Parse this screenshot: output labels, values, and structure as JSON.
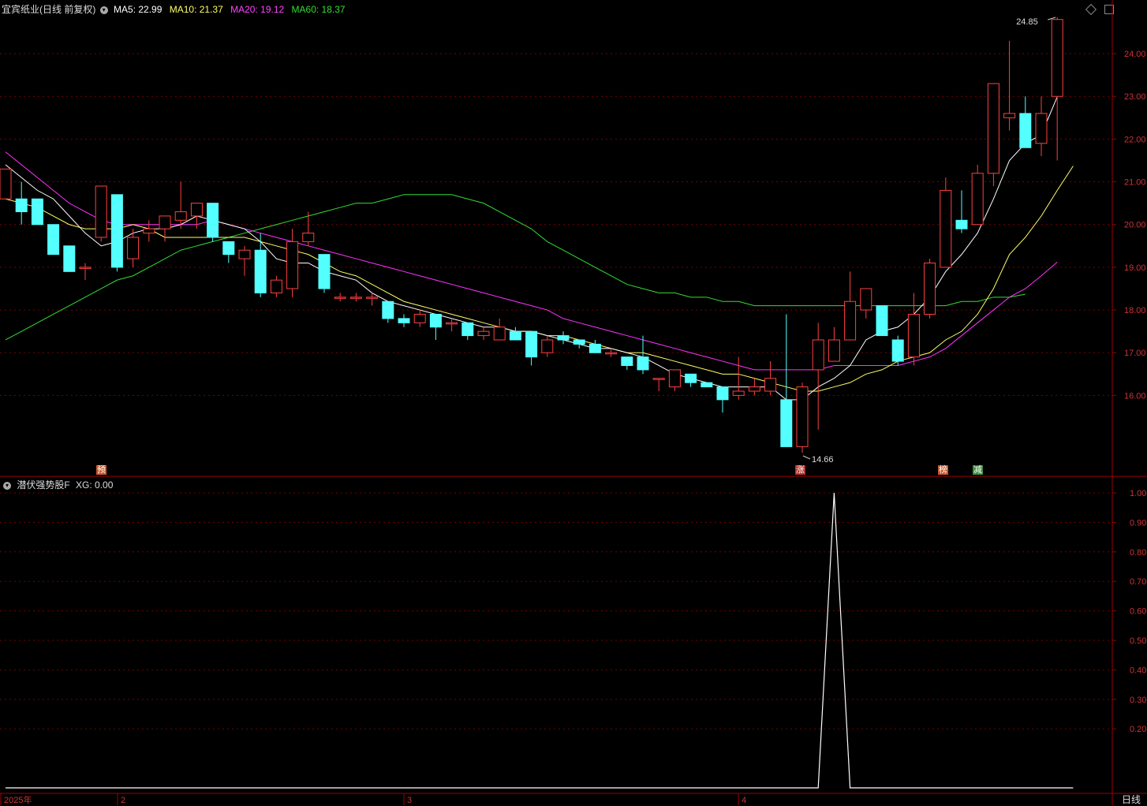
{
  "header": {
    "title": "宜宾纸业(日线 前复权)",
    "ma5_label": "MA5: 22.99",
    "ma10_label": "MA10: 21.37",
    "ma20_label": "MA20: 19.12",
    "ma60_label": "MA60: 18.37"
  },
  "indicator": {
    "name": "潜伏强势股F",
    "value_label": "XG: 0.00"
  },
  "footer": {
    "period_label": "日线"
  },
  "signals": [
    {
      "text": "预",
      "color": "#c8552a"
    },
    {
      "text": "涨",
      "color": "#b0302a"
    },
    {
      "text": "榜",
      "color": "#c8552a"
    },
    {
      "text": "减",
      "color": "#3a8a3a"
    }
  ],
  "colors": {
    "up": "#ff4040",
    "down": "#54ffff",
    "ma5": "#ffffff",
    "ma10": "#ffff66",
    "ma20": "#ff33ff",
    "ma60": "#33dd33",
    "axis": "#a00000",
    "grid": "#7a0000"
  },
  "chart_data": [
    {
      "type": "candlestick",
      "ylim": [
        14.5,
        25.0
      ],
      "yticks": [
        "16.00",
        "17.00",
        "18.00",
        "19.00",
        "20.00",
        "21.00",
        "22.00",
        "23.00",
        "24.00"
      ],
      "xticks": [
        "2025年",
        "2",
        "3",
        "4"
      ],
      "annotations": {
        "high": "24.85",
        "low": "14.66"
      },
      "series_names": [
        "MA5",
        "MA10",
        "MA20",
        "MA60"
      ],
      "ohlc": [
        [
          20.6,
          21.3,
          20.6,
          21.3
        ],
        [
          20.6,
          21.0,
          20.0,
          20.3
        ],
        [
          20.6,
          20.6,
          20.0,
          20.0
        ],
        [
          20.0,
          20.0,
          19.3,
          19.3
        ],
        [
          19.5,
          19.5,
          18.9,
          18.9
        ],
        [
          19.0,
          19.1,
          18.7,
          19.0
        ],
        [
          19.7,
          20.9,
          19.6,
          20.9
        ],
        [
          20.7,
          20.7,
          18.9,
          19.0
        ],
        [
          19.2,
          19.9,
          19.0,
          19.7
        ],
        [
          19.8,
          20.1,
          19.6,
          19.9
        ],
        [
          19.9,
          20.2,
          19.6,
          20.2
        ],
        [
          20.1,
          21.0,
          19.9,
          20.3
        ],
        [
          20.2,
          20.5,
          19.9,
          20.5
        ],
        [
          20.5,
          20.5,
          19.6,
          19.7
        ],
        [
          19.6,
          19.6,
          19.1,
          19.3
        ],
        [
          19.2,
          19.5,
          18.8,
          19.4
        ],
        [
          19.4,
          19.8,
          18.3,
          18.4
        ],
        [
          18.4,
          18.8,
          18.3,
          18.7
        ],
        [
          18.5,
          19.9,
          18.3,
          19.6
        ],
        [
          19.6,
          20.3,
          19.5,
          19.8
        ],
        [
          19.3,
          19.3,
          18.4,
          18.5
        ],
        [
          18.3,
          18.4,
          18.2,
          18.3
        ],
        [
          18.3,
          18.4,
          18.2,
          18.3
        ],
        [
          18.3,
          18.4,
          18.1,
          18.3
        ],
        [
          18.2,
          18.2,
          17.7,
          17.8
        ],
        [
          17.8,
          17.9,
          17.6,
          17.7
        ],
        [
          17.7,
          18.0,
          17.6,
          17.9
        ],
        [
          17.9,
          17.9,
          17.3,
          17.6
        ],
        [
          17.7,
          17.8,
          17.5,
          17.7
        ],
        [
          17.7,
          17.7,
          17.3,
          17.4
        ],
        [
          17.4,
          17.6,
          17.3,
          17.5
        ],
        [
          17.3,
          17.8,
          17.3,
          17.6
        ],
        [
          17.5,
          17.6,
          17.3,
          17.3
        ],
        [
          17.5,
          17.5,
          16.7,
          16.9
        ],
        [
          17.0,
          17.4,
          16.9,
          17.3
        ],
        [
          17.4,
          17.5,
          17.2,
          17.3
        ],
        [
          17.3,
          17.3,
          17.1,
          17.2
        ],
        [
          17.2,
          17.3,
          17.0,
          17.0
        ],
        [
          17.0,
          17.1,
          16.9,
          17.0
        ],
        [
          16.9,
          16.9,
          16.6,
          16.7
        ],
        [
          16.9,
          17.4,
          16.5,
          16.6
        ],
        [
          16.4,
          16.4,
          16.1,
          16.4
        ],
        [
          16.2,
          16.6,
          16.1,
          16.6
        ],
        [
          16.5,
          16.5,
          16.2,
          16.3
        ],
        [
          16.3,
          16.3,
          16.2,
          16.2
        ],
        [
          16.2,
          16.2,
          15.6,
          15.9
        ],
        [
          16.0,
          16.9,
          15.9,
          16.1
        ],
        [
          16.1,
          16.4,
          16.0,
          16.2
        ],
        [
          16.1,
          16.8,
          16.0,
          16.4
        ],
        [
          15.9,
          17.9,
          14.8,
          14.8
        ],
        [
          14.8,
          16.3,
          14.66,
          16.2
        ],
        [
          16.6,
          17.7,
          15.2,
          17.3
        ],
        [
          16.8,
          17.6,
          16.8,
          17.3
        ],
        [
          17.3,
          18.9,
          17.3,
          18.2
        ],
        [
          18.0,
          18.5,
          17.8,
          18.5
        ],
        [
          18.1,
          18.1,
          17.4,
          17.4
        ],
        [
          17.3,
          17.4,
          16.7,
          16.8
        ],
        [
          16.9,
          18.4,
          16.7,
          17.9
        ],
        [
          17.9,
          19.2,
          17.8,
          19.1
        ],
        [
          19.0,
          21.1,
          19.0,
          20.8
        ],
        [
          20.1,
          20.8,
          19.8,
          19.9
        ],
        [
          20.0,
          21.4,
          20.0,
          21.2
        ],
        [
          21.2,
          23.3,
          20.9,
          23.3
        ],
        [
          22.5,
          24.3,
          22.2,
          22.6
        ],
        [
          22.6,
          23.0,
          21.8,
          21.8
        ],
        [
          21.9,
          23.0,
          21.6,
          22.6
        ],
        [
          23.0,
          24.85,
          21.5,
          24.8
        ]
      ],
      "ma5": [
        21.4,
        21.1,
        20.8,
        20.6,
        20.2,
        19.8,
        19.5,
        19.6,
        19.8,
        19.9,
        19.9,
        20.0,
        20.2,
        20.1,
        20.0,
        19.9,
        19.6,
        19.2,
        19.1,
        19.1,
        18.9,
        18.8,
        18.7,
        18.4,
        18.2,
        18.1,
        18.0,
        17.9,
        17.8,
        17.7,
        17.6,
        17.6,
        17.5,
        17.5,
        17.4,
        17.3,
        17.2,
        17.1,
        17.1,
        17.0,
        16.9,
        16.7,
        16.5,
        16.4,
        16.3,
        16.2,
        16.2,
        16.2,
        16.2,
        15.9,
        15.9,
        16.2,
        16.4,
        16.7,
        17.3,
        17.5,
        17.6,
        17.9,
        18.3,
        18.9,
        19.3,
        19.8,
        20.6,
        21.5,
        21.9,
        22.1,
        22.99
      ],
      "ma10": [
        20.6,
        20.5,
        20.4,
        20.2,
        20.0,
        19.9,
        19.9,
        19.9,
        20.0,
        19.9,
        19.7,
        19.7,
        19.7,
        19.7,
        19.7,
        19.7,
        19.6,
        19.5,
        19.4,
        19.3,
        19.1,
        18.9,
        18.8,
        18.6,
        18.4,
        18.2,
        18.1,
        18.0,
        17.9,
        17.8,
        17.7,
        17.6,
        17.5,
        17.5,
        17.4,
        17.4,
        17.3,
        17.2,
        17.1,
        17.0,
        17.0,
        16.9,
        16.8,
        16.7,
        16.6,
        16.5,
        16.5,
        16.4,
        16.3,
        16.2,
        16.1,
        16.1,
        16.2,
        16.3,
        16.5,
        16.6,
        16.8,
        16.9,
        17.0,
        17.3,
        17.5,
        17.9,
        18.5,
        19.3,
        19.7,
        20.2,
        20.8,
        21.37
      ],
      "ma20": [
        21.7,
        21.4,
        21.1,
        20.8,
        20.5,
        20.3,
        20.1,
        20.0,
        20.0,
        20.0,
        20.0,
        20.0,
        20.0,
        20.1,
        20.0,
        19.9,
        19.8,
        19.7,
        19.6,
        19.5,
        19.4,
        19.3,
        19.2,
        19.1,
        19.0,
        18.9,
        18.8,
        18.7,
        18.6,
        18.5,
        18.4,
        18.3,
        18.2,
        18.1,
        18.0,
        17.8,
        17.7,
        17.6,
        17.5,
        17.4,
        17.3,
        17.2,
        17.1,
        17.0,
        16.9,
        16.8,
        16.7,
        16.6,
        16.6,
        16.6,
        16.6,
        16.6,
        16.7,
        16.7,
        16.7,
        16.7,
        16.7,
        16.8,
        16.9,
        17.1,
        17.4,
        17.7,
        18.0,
        18.3,
        18.5,
        18.8,
        19.12
      ],
      "ma60": [
        17.3,
        17.5,
        17.7,
        17.9,
        18.1,
        18.3,
        18.5,
        18.7,
        18.8,
        19.0,
        19.2,
        19.4,
        19.5,
        19.6,
        19.7,
        19.8,
        19.9,
        20.0,
        20.1,
        20.2,
        20.3,
        20.4,
        20.5,
        20.5,
        20.6,
        20.7,
        20.7,
        20.7,
        20.7,
        20.6,
        20.5,
        20.3,
        20.1,
        19.9,
        19.6,
        19.4,
        19.2,
        19.0,
        18.8,
        18.6,
        18.5,
        18.4,
        18.4,
        18.3,
        18.3,
        18.2,
        18.2,
        18.1,
        18.1,
        18.1,
        18.1,
        18.1,
        18.1,
        18.1,
        18.1,
        18.1,
        18.1,
        18.1,
        18.1,
        18.1,
        18.2,
        18.2,
        18.3,
        18.3,
        18.37
      ],
      "signal_days": [
        6,
        50,
        59,
        61
      ]
    },
    {
      "type": "line",
      "name": "XG",
      "ylim": [
        0,
        1.05
      ],
      "yticks": [
        "0.20",
        "0.30",
        "0.40",
        "0.50",
        "0.60",
        "0.70",
        "0.80",
        "0.90",
        "1.00"
      ],
      "values": [
        0,
        0,
        0,
        0,
        0,
        0,
        0,
        0,
        0,
        0,
        0,
        0,
        0,
        0,
        0,
        0,
        0,
        0,
        0,
        0,
        0,
        0,
        0,
        0,
        0,
        0,
        0,
        0,
        0,
        0,
        0,
        0,
        0,
        0,
        0,
        0,
        0,
        0,
        0,
        0,
        0,
        0,
        0,
        0,
        0,
        0,
        0,
        0,
        0,
        0,
        0,
        0,
        1,
        0,
        0,
        0,
        0,
        0,
        0,
        0,
        0,
        0,
        0,
        0,
        0,
        0,
        0,
        0
      ]
    }
  ]
}
